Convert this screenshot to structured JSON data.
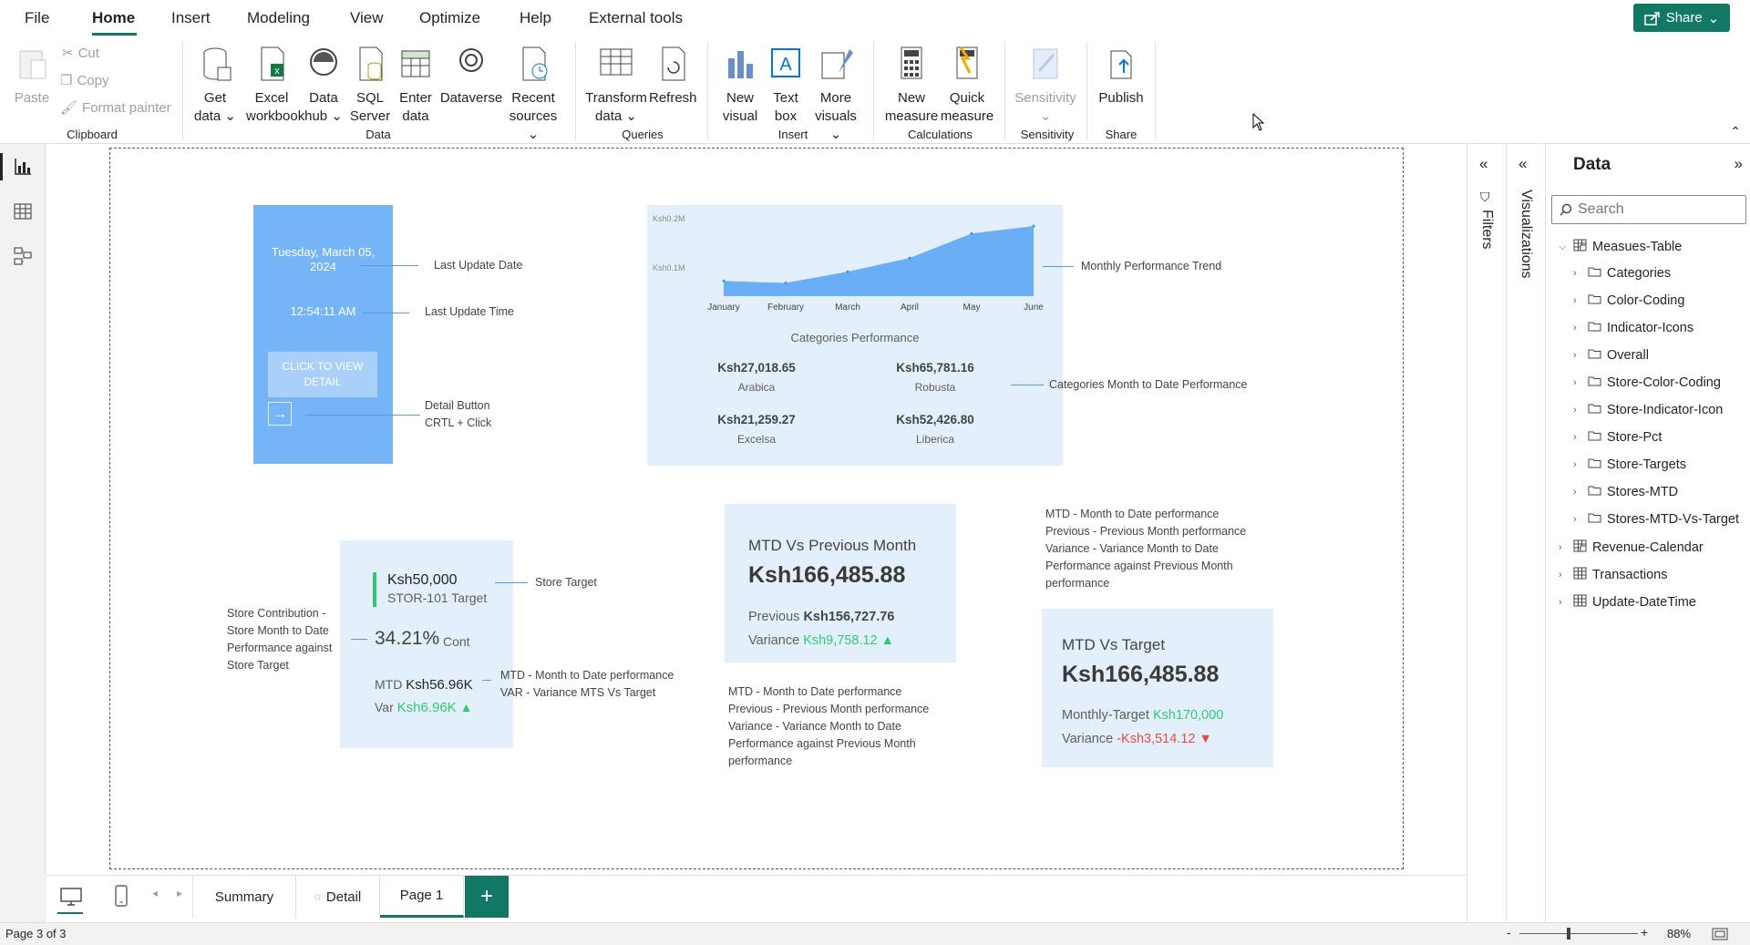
{
  "menu": {
    "file": "File",
    "home": "Home",
    "insert": "Insert",
    "modeling": "Modeling",
    "view": "View",
    "optimize": "Optimize",
    "help": "Help",
    "external": "External tools",
    "share": "Share"
  },
  "ribbon": {
    "paste": "Paste",
    "cut": "Cut",
    "copy": "Copy",
    "format_painter": "Format painter",
    "clipboard": "Clipboard",
    "get_data": [
      "Get",
      "data"
    ],
    "excel": [
      "Excel",
      "workbook"
    ],
    "data_hub": [
      "Data",
      "hub"
    ],
    "sql": [
      "SQL",
      "Server"
    ],
    "enter_data": [
      "Enter",
      "data"
    ],
    "dataverse": "Dataverse",
    "recent": [
      "Recent",
      "sources"
    ],
    "data_group": "Data",
    "transform": [
      "Transform",
      "data"
    ],
    "refresh": "Refresh",
    "queries": "Queries",
    "new_visual": [
      "New",
      "visual"
    ],
    "text_box": [
      "Text",
      "box"
    ],
    "more_visuals": [
      "More",
      "visuals"
    ],
    "insert_group": "Insert",
    "new_measure": [
      "New",
      "measure"
    ],
    "quick_measure": [
      "Quick",
      "measure"
    ],
    "calculations": "Calculations",
    "sensitivity": "Sensitivity",
    "sensitivity_group": "Sensitivity",
    "publish": "Publish",
    "share_group": "Share"
  },
  "report": {
    "date": "Tuesday, March 05, 2024",
    "time": "12:54:11 AM",
    "view_detail": "CLICK TO VIEW DETAIL",
    "ann_last_date": "Last Update Date",
    "ann_last_time": "Last Update Time",
    "ann_detail1": "Detail Button",
    "ann_detail2": "CRTL + Click",
    "ann_trend": "Monthly Performance Trend",
    "ann_cat_mtd": "Categories Month to Date Performance",
    "cat_title": "Categories Performance",
    "categories": [
      {
        "value": "Ksh27,018.65",
        "name": "Arabica"
      },
      {
        "value": "Ksh65,781.16",
        "name": "Robusta"
      },
      {
        "value": "Ksh21,259.27",
        "name": "Excelsa"
      },
      {
        "value": "Ksh52,426.80",
        "name": "Liberica"
      }
    ],
    "store_target_value": "Ksh50,000",
    "store_target_label": "STOR-101 Target",
    "ann_store_target": "Store Target",
    "cont_value": "34.21%",
    "cont_label": "Cont",
    "mtd_label": "MTD",
    "mtd_value": "Ksh56.96K",
    "var_label": "Var",
    "var_value": "Ksh6.96K",
    "ann_store_contrib": [
      "Store Contribution -",
      "Store Month to Date",
      "Performance against",
      "Store Target"
    ],
    "ann_mtd_var": [
      "MTD - Month to Date performance",
      "VAR - Variance MTS Vs Target"
    ],
    "mvp_title": "MTD Vs Previous Month",
    "mvp_value": "Ksh166,485.88",
    "mvp_prev_label": "Previous",
    "mvp_prev_value": "Ksh156,727.76",
    "mvp_var_label": "Variance",
    "mvp_var_value": "Ksh9,758.12",
    "ann_mvp": [
      "MTD - Month to Date performance",
      "Previous - Previous Month performance",
      "Variance - Variance Month to Date",
      "Performance against Previous Month",
      "performance"
    ],
    "ann_mvt": [
      "MTD - Month to Date performance",
      "Previous - Previous Month performance",
      "Variance - Variance Month to Date",
      "Performance against Previous Month",
      "performance"
    ],
    "mvt_title": "MTD Vs Target",
    "mvt_value": "Ksh166,485.88",
    "mvt_target_label": "Monthly-Target",
    "mvt_target_value": "Ksh170,000",
    "mvt_var_label": "Variance",
    "mvt_var_value": "-Ksh3,514.12"
  },
  "chart_data": {
    "type": "area",
    "categories": [
      "January",
      "February",
      "March",
      "April",
      "May",
      "June"
    ],
    "values": [
      71000,
      67000,
      90000,
      118000,
      168000,
      183000
    ],
    "ytick_labels": [
      "Ksh0.1M",
      "Ksh0.2M"
    ],
    "ylim": [
      40000,
      200000
    ],
    "color": "#6aaef5"
  },
  "panels": {
    "filters": "Filters",
    "visualizations": "Visualizations",
    "data": "Data",
    "search_placeholder": "Search"
  },
  "tree": [
    {
      "label": "Measues-Table",
      "type": "table",
      "level": 0,
      "expanded": true
    },
    {
      "label": "Categories",
      "type": "folder",
      "level": 1
    },
    {
      "label": "Color-Coding",
      "type": "folder",
      "level": 1
    },
    {
      "label": "Indicator-Icons",
      "type": "folder",
      "level": 1
    },
    {
      "label": "Overall",
      "type": "folder",
      "level": 1
    },
    {
      "label": "Store-Color-Coding",
      "type": "folder",
      "level": 1
    },
    {
      "label": "Store-Indicator-Icon",
      "type": "folder",
      "level": 1
    },
    {
      "label": "Store-Pct",
      "type": "folder",
      "level": 1
    },
    {
      "label": "Store-Targets",
      "type": "folder",
      "level": 1
    },
    {
      "label": "Stores-MTD",
      "type": "folder",
      "level": 1
    },
    {
      "label": "Stores-MTD-Vs-Target",
      "type": "folder",
      "level": 1
    },
    {
      "label": "Revenue-Calendar",
      "type": "table",
      "level": 0
    },
    {
      "label": "Transactions",
      "type": "grid",
      "level": 0
    },
    {
      "label": "Update-DateTime",
      "type": "grid",
      "level": 0
    }
  ],
  "tabs": {
    "summary": "Summary",
    "detail": "Detail",
    "page1": "Page 1",
    "add": "+"
  },
  "status": {
    "page": "Page 3 of 3",
    "zoom": "88%"
  },
  "colors": {
    "accent": "#117865",
    "green": "#2ecc71",
    "red": "#e74c3c",
    "card_blue": "#75b4f6",
    "card_light": "#e3f0fb"
  }
}
